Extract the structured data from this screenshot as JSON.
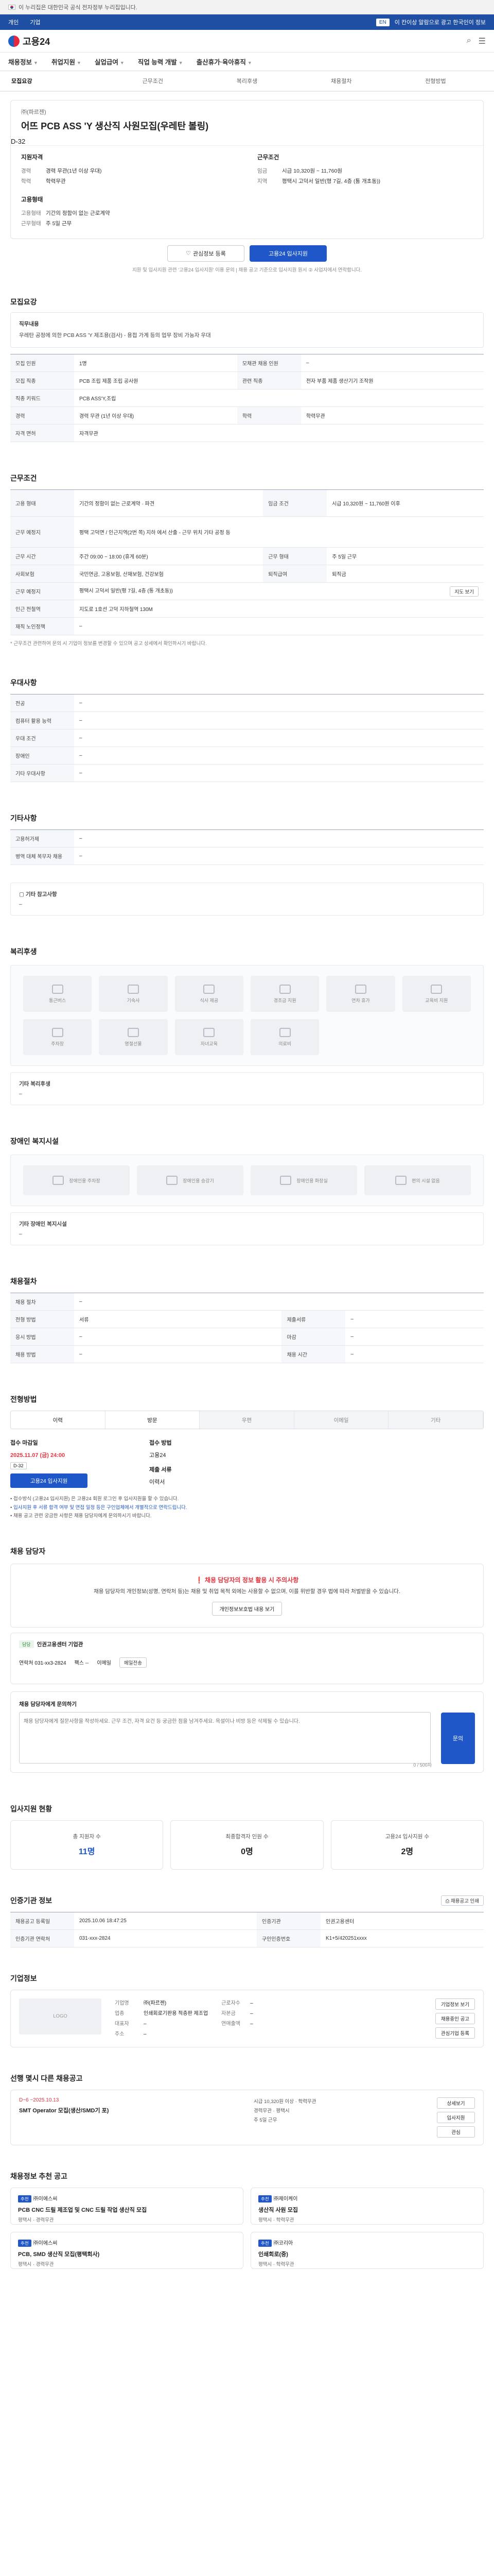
{
  "gov_bar": {
    "text": "이 누리집은 대한민국 공식 전자정부 누리집입니다."
  },
  "util": {
    "links": [
      "개인",
      "기업"
    ],
    "right_chip": "EN",
    "right_text": "이 칸이상 알람으로 광고 한국인이 정보"
  },
  "brand": {
    "logo_text": "고용24"
  },
  "gnb": {
    "items": [
      "채용정보",
      "취업지원",
      "실업급여",
      "직업 능력 개발",
      "출산휴가·육아휴직"
    ]
  },
  "tabs": [
    "모집요강",
    "근무조건",
    "복리후생",
    "채용절차",
    "전형방법"
  ],
  "job": {
    "company": "㈜(파르젠)",
    "title": "어뜨 PCB ASS 'Y 생산직 사원모집(우레탄 볼링)",
    "dday": "D-32",
    "summary_left_title": "지원자격",
    "summary_left": [
      {
        "k": "경력",
        "v": "경력 무관(1년 이상 우대)"
      },
      {
        "k": "학력",
        "v": "학력무관"
      }
    ],
    "summary_right_title": "근무조건",
    "summary_right": [
      {
        "k": "임금",
        "v": "시급 10,320원 ~ 11,760원"
      },
      {
        "k": "지역",
        "v": "평택시 고덕서 일반(평 7길, 4층 (통 개초동))"
      }
    ],
    "summary_left2_title": "고용형태",
    "summary_left2": [
      {
        "k": "고용형태",
        "v": "기간의 정함이 없는 근로계약"
      },
      {
        "k": "근무형태",
        "v": "주 5일 근무"
      }
    ],
    "btn_interest": "관심정보 등록",
    "btn_apply": "고용24 입사지원",
    "note": "지원 및 입사지원 관련 '고용24 입사지원' 이용 문의 | 채용 공고 기준으로 입사지원 원서 ② 사업자에서 연락합니다."
  },
  "recruit": {
    "title": "모집요강",
    "duty_title": "직무내용",
    "duty_text": "우레탄 공정에 의한 PCB ASS 'Y 제조용(검사) - 용접 가계 등의 업무 장비 가능자 우대",
    "rows": [
      {
        "k": "모집 인원",
        "v": "1명",
        "k2": "모채관 채용 인원",
        "v2": "–"
      },
      {
        "k": "모집 직종",
        "v": "PCB 조립 제품 조립 공사원",
        "k2": "관련 직종",
        "v2": "전자 부품 제품 생산기기 조작원"
      },
      {
        "k": "직종 키워드",
        "v": "PCB ASS'Y,조립",
        "k2": "",
        "v2": ""
      },
      {
        "k": "경력",
        "v": "경력 무관 (1년 이상 우대)",
        "k2": "학력",
        "v2": "학력무관"
      },
      {
        "k": "자격 면허",
        "v": "자격무관",
        "k2": "",
        "v2": ""
      }
    ]
  },
  "conditions": {
    "title": "근무조건",
    "rows": [
      {
        "k": "고용 형태",
        "v": "기간의 정함이 없는 근로계약 · 파견",
        "k2": "임금 조건",
        "v2": "시급 10,320원 ~ 11,760원 이후"
      },
      {
        "k": "근무 예정지",
        "v": "평택 고덕면 / 인근지역(2번 쪽) 지하 에서 산출 - 근무 위치 기타 공정 등",
        "k2": "",
        "v2": ""
      },
      {
        "k": "근무 시간",
        "v": "주간 09:00 ~ 18:00 (휴게 60분)",
        "k2": "근무 형태",
        "v2": "주 5일 근무"
      },
      {
        "k": "사회보험",
        "v": "국민연금, 고용보험, 산재보험, 건강보험",
        "k2": "퇴직급여",
        "v2": "퇴직금"
      },
      {
        "k": "근무 예정지",
        "v": "평택시 고덕서 일반(평 7길, 4층 (통 개초동))",
        "k2": "",
        "v2": ""
      },
      {
        "k": "인근 전철역",
        "v": "지도로 1호선 고덕 지하철역 130M",
        "k2": "",
        "v2": ""
      },
      {
        "k": "재직 노인정책",
        "v": "–",
        "k2": "",
        "v2": ""
      }
    ],
    "map_btn": "지도 보기",
    "foot": "* 근무조건 관련하여 문의 시 기업이 정보를 변경할 수 있으며 공고 상세에서 확인하시기 바랍니다."
  },
  "etc": {
    "title": "우대사항",
    "rows": [
      {
        "k": "전공",
        "v": "–"
      },
      {
        "k": "컴퓨터 활용 능력",
        "v": "–"
      },
      {
        "k": "우대 조건",
        "v": "–"
      },
      {
        "k": "장애인",
        "v": "–"
      },
      {
        "k": "기타 우대사항",
        "v": "–"
      }
    ]
  },
  "other": {
    "title": "기타사항",
    "rows": [
      {
        "k": "고용허가제",
        "v": "–"
      },
      {
        "k": "병역 대체 복무자 채용",
        "v": "–"
      }
    ],
    "box_title": "기타 참고사항",
    "box_text": "–"
  },
  "welfare": {
    "title": "복리후생",
    "items": [
      "통근버스",
      "기숙사",
      "식사 제공",
      "경조금 지원",
      "연차 휴가",
      "교육비 지원",
      "주차장",
      "명절선물",
      "자녀교육",
      "의료비",
      "",
      ""
    ],
    "box_title": "기타 복리후생",
    "box_text": "–"
  },
  "disabled": {
    "title": "장애인 복지시설",
    "items": [
      "장애인용 주차장",
      "장애인용 승강기",
      "장애인용 화장실",
      "편의 시설 없음"
    ],
    "box_title": "기타 장애인 복지시설",
    "box_text": "–"
  },
  "process": {
    "title": "채용절차",
    "rows": [
      {
        "k": "채용 절차",
        "v": "–"
      },
      {
        "k": "전형 방법",
        "v": "서류",
        "k2": "제출서류",
        "v2": "–"
      },
      {
        "k": "응시 방법",
        "v": "–",
        "k2": "마감",
        "v2": "–"
      },
      {
        "k": "채용 방법",
        "v": "–",
        "k2": "채용 시간",
        "v2": "–"
      }
    ]
  },
  "apply": {
    "title": "전형방법",
    "tabs": [
      "이력",
      "방문",
      "우편",
      "이메일",
      "기타"
    ],
    "deadline_title": "접수 마감일",
    "deadline": "2025.11.07 (금) 24:00",
    "deadline_tag": "D-32",
    "deadline_btn": "고용24 입사지원",
    "method_title": "접수 방법",
    "method": "고용24",
    "docs_title": "제출 서류",
    "docs": "이력서",
    "notes": [
      "접수방식 (고용24 입사지원) 은 고용24 회원 로그인 후 입사지원을 할 수 있습니다.",
      "입사지원 후 서류 합격 여부 및 면접 일정 등은 구인업체에서 개별적으로 연락드립니다.",
      "채용 공고 관련 궁금한 사항은 채용 담당자에게 문의하시기 바랍니다."
    ]
  },
  "manager": {
    "title": "채용 담당자",
    "warn": "채용 담당자의 정보 활용 시 주의사항",
    "text": "채용 담당자의 개인정보(성명, 연락처 등)는 채용 및 취업 목적 외에는 사용할 수 없으며, 이를 위반할 경우 법에 따라 처벌받을 수 있습니다.",
    "more": "개인정보보호법 내용 보기",
    "badge": "담당",
    "name": "인권고용센터 기업관",
    "phone": "연락처 031-xx3-2824",
    "fax": "팩스 --",
    "email": "이메일",
    "email_btn": "메일전송"
  },
  "inquiry": {
    "label": "채용 담당자에게 문의하기",
    "placeholder": "채용 담당자에게 질문사항을 작성하세요. 근무 조건, 자격 요건 등 궁금한 점을 남겨주세요. 욕설이나 비방 등은 삭제될 수 있습니다.",
    "counter": "0 / 500자",
    "send": "문의"
  },
  "stats": {
    "title": "입사지원 현황",
    "items": [
      {
        "label": "총 지원자 수",
        "num": "11명"
      },
      {
        "label": "최종합격자 인원 수",
        "num": "0명"
      },
      {
        "label": "고용24 입사지원 수",
        "num": "2명"
      }
    ]
  },
  "info": {
    "title": "인증기관 정보",
    "rows": [
      {
        "k": "채용공고 등록일",
        "v": "2025.10.06 18:47:25",
        "k2": "인증기관",
        "v2": "인권고용센터"
      },
      {
        "k": "인증기관 연락처",
        "v": "031-xxx-2824",
        "k2": "구인인증번호",
        "v2": "K1+5/420251xxxx"
      }
    ],
    "print_btn": "채용공고 인쇄"
  },
  "company": {
    "title": "기업정보",
    "logo": "LOGO",
    "rows": [
      {
        "k": "기업명",
        "v": "㈜(파르젠)"
      },
      {
        "k": "업종",
        "v": "인쇄회로기판용 적층판 제조업"
      },
      {
        "k": "대표자",
        "v": "–"
      },
      {
        "k": "주소",
        "v": "–"
      }
    ],
    "rows2": [
      {
        "k": "근로자수",
        "v": "–"
      },
      {
        "k": "자본금",
        "v": "–"
      },
      {
        "k": "연매출액",
        "v": "–"
      }
    ],
    "btns": [
      "기업정보 보기",
      "채용중인 공고",
      "관심기업 등록"
    ]
  },
  "same": {
    "title": "선행 몇시 다른 채용공고",
    "dl": "D~6  ~2025.10.13",
    "job_title": "SMT Operator 모집(생산/SMD기 포)",
    "info": [
      "시급 10,320원 이상 · 학력무관",
      "경력무관 · 평택시",
      "주 5일 근무"
    ],
    "btns": [
      "상세보기",
      "입사지원",
      "관심"
    ]
  },
  "recommend": {
    "title": "채용정보 추천 공고",
    "items": [
      {
        "pill": "추천",
        "co": "㈜이에스씨",
        "t": "PCB CNC 드릴 제조업 및 CNC 드릴 작업 생산직 모집",
        "m": "평택시 · 경력무관"
      },
      {
        "pill": "추천",
        "co": "㈜제이케이",
        "t": "생산직 사원 모집",
        "m": "평택시 · 학력무관"
      },
      {
        "pill": "추천",
        "co": "㈜이에스씨",
        "t": "PCB, SMD 생산직 모집(평택회사)",
        "m": "평택시 · 경력무관"
      },
      {
        "pill": "추천",
        "co": "㈜코리아",
        "t": "인쇄회로(중)",
        "m": "평택시 · 학력무관"
      }
    ]
  }
}
